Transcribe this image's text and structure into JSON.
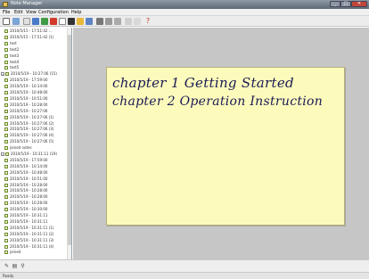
{
  "window": {
    "title": "Note Manager"
  },
  "menu": [
    "File",
    "Edit",
    "View",
    "Configuration",
    "Help"
  ],
  "toolbar": {
    "icons": [
      "new-note-icon",
      "open-icon",
      "back-icon",
      "forward-icon",
      "cut-icon",
      "delete-icon",
      "page-icon",
      "lock-icon",
      "print-icon",
      "export-icon",
      "grid-icon",
      "list-icon",
      "columns-icon",
      "check-icon",
      "pen-icon",
      "help-icon"
    ]
  },
  "tree": [
    {
      "label": "2010/5/15 - 17:51:42 …",
      "type": "note"
    },
    {
      "label": "2010/5/15 - 17:51:42 (1)",
      "type": "note"
    },
    {
      "label": "test",
      "type": "note"
    },
    {
      "label": "test2",
      "type": "note"
    },
    {
      "label": "test3",
      "type": "note"
    },
    {
      "label": "test4",
      "type": "note"
    },
    {
      "label": "test5",
      "type": "note"
    },
    {
      "label": "2010/5/19 - 10:27:06 (15)",
      "type": "folder"
    },
    {
      "label": "2010/5/19 - 17:59:00",
      "type": "note"
    },
    {
      "label": "2010/5/19 - 10:14:00",
      "type": "note"
    },
    {
      "label": "2010/5/19 - 10:48:00",
      "type": "note"
    },
    {
      "label": "2010/5/19 - 10:51:00",
      "type": "note"
    },
    {
      "label": "2010/5/19 - 10:28:00",
      "type": "note"
    },
    {
      "label": "2010/5/19 - 10:27:06",
      "type": "note"
    },
    {
      "label": "2010/5/19 - 10:27:06 (1)",
      "type": "note"
    },
    {
      "label": "2010/5/19 - 10:27:06 (2)",
      "type": "note"
    },
    {
      "label": "2010/5/19 - 10:27:06 (3)",
      "type": "note"
    },
    {
      "label": "2010/5/19 - 10:27:06 (4)",
      "type": "note"
    },
    {
      "label": "2010/5/19 - 10:27:06 (5)",
      "type": "note"
    },
    {
      "label": "joined notes",
      "type": "note"
    },
    {
      "label": "2010/5/19 - 10:31:11 (19)",
      "type": "folder"
    },
    {
      "label": "2010/5/19 - 17:59:00",
      "type": "note"
    },
    {
      "label": "2010/5/19 - 10:14:00",
      "type": "note"
    },
    {
      "label": "2010/5/19 - 10:48:00",
      "type": "note"
    },
    {
      "label": "2010/5/19 - 10:51:00",
      "type": "note"
    },
    {
      "label": "2010/5/19 - 10:28:00",
      "type": "note"
    },
    {
      "label": "2010/5/19 - 10:28:00",
      "type": "note"
    },
    {
      "label": "2010/5/19 - 10:28:00",
      "type": "note"
    },
    {
      "label": "2010/5/19 - 10:28:00",
      "type": "note"
    },
    {
      "label": "2010/5/19 - 10:30:00",
      "type": "note"
    },
    {
      "label": "2010/5/19 - 10:31:11",
      "type": "note"
    },
    {
      "label": "2010/5/19 - 10:31:11",
      "type": "note"
    },
    {
      "label": "2010/5/19 - 10:31:11 (1)",
      "type": "note"
    },
    {
      "label": "2010/5/19 - 10:31:11 (2)",
      "type": "note"
    },
    {
      "label": "2010/5/19 - 10:31:11 (3)",
      "type": "note"
    },
    {
      "label": "2010/5/19 - 10:31:11 (4)",
      "type": "note"
    },
    {
      "label": "joined",
      "type": "note"
    }
  ],
  "note": {
    "line1": "chapter 1  Getting Started",
    "line2": "chapter 2  Operation Instruction"
  },
  "bottom_icons": [
    "pen-icon",
    "page-icon",
    "search-icon"
  ],
  "status": {
    "text": "Ready"
  },
  "colors": {
    "note_bg": "#fdfbbb",
    "workspace_bg": "#c6c6c6",
    "ink": "#1a1a55"
  }
}
